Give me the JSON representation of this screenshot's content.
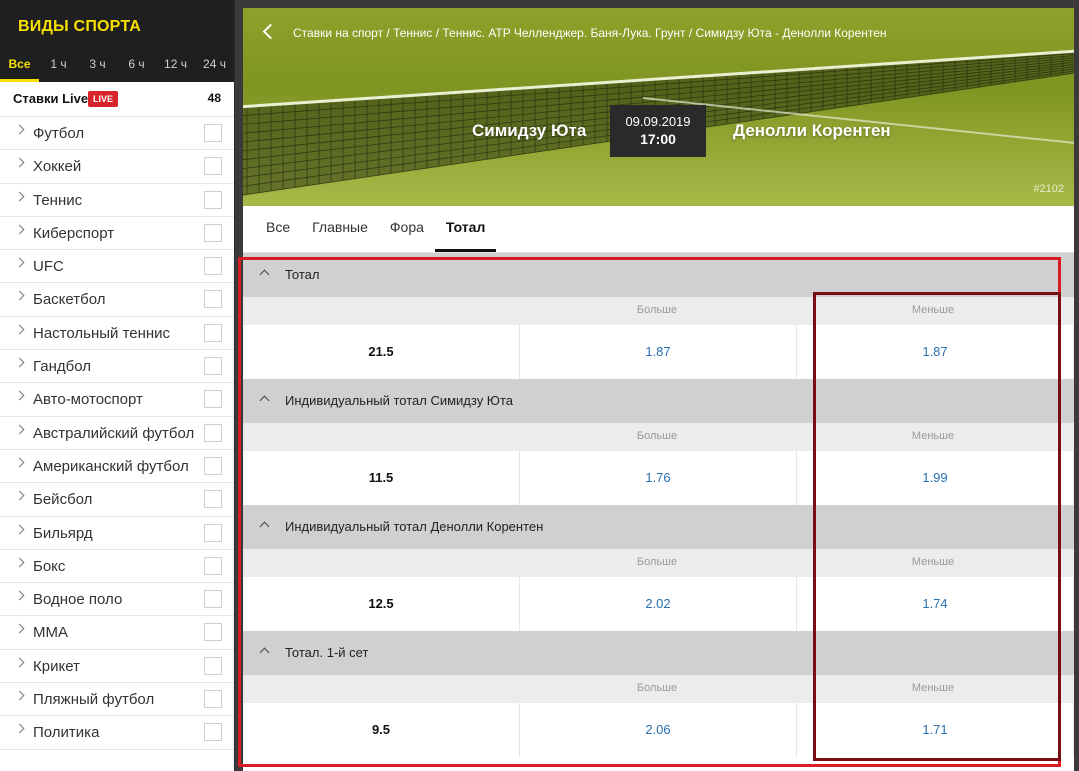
{
  "sidebar": {
    "title": "ВИДЫ СПОРТА",
    "tabs": [
      "Все",
      "1 ч",
      "3 ч",
      "6 ч",
      "12 ч",
      "24 ч"
    ],
    "live": {
      "label": "Ставки Live",
      "badge": "LIVE",
      "count": "48"
    },
    "sports": [
      "Футбол",
      "Хоккей",
      "Теннис",
      "Киберспорт",
      "UFC",
      "Баскетбол",
      "Настольный теннис",
      "Гандбол",
      "Авто-мотоспорт",
      "Австралийский футбол",
      "Американский футбол",
      "Бейсбол",
      "Бильярд",
      "Бокс",
      "Водное поло",
      "MMA",
      "Крикет",
      "Пляжный футбол",
      "Политика"
    ]
  },
  "header": {
    "breadcrumb": "Ставки на спорт  /  Теннис  /  Теннис. ATP Челленджер. Баня-Лука. Грунт  /  Симидзу Юта - Денолли Корентен",
    "team_left": "Симидзу Юта",
    "team_right": "Денолли Корентен",
    "date": "09.09.2019",
    "time": "17:00",
    "event_id": "#2102"
  },
  "tabs": [
    "Все",
    "Главные",
    "Фора",
    "Тотал"
  ],
  "markets": [
    {
      "title": "Тотал",
      "over_label": "Больше",
      "under_label": "Меньше",
      "total": "21.5",
      "over": "1.87",
      "under": "1.87"
    },
    {
      "title": "Индивидуальный тотал Симидзу Юта",
      "over_label": "Больше",
      "under_label": "Меньше",
      "total": "11.5",
      "over": "1.76",
      "under": "1.99"
    },
    {
      "title": "Индивидуальный тотал Денолли Корентен",
      "over_label": "Больше",
      "under_label": "Меньше",
      "total": "12.5",
      "over": "2.02",
      "under": "1.74"
    },
    {
      "title": "Тотал. 1-й сет",
      "over_label": "Больше",
      "under_label": "Меньше",
      "total": "9.5",
      "over": "2.06",
      "under": "1.71"
    }
  ],
  "colors": {
    "accent": "#f5e000",
    "live": "#d8232a",
    "odds": "#2a6fb0",
    "highlight": "#d91c24"
  }
}
